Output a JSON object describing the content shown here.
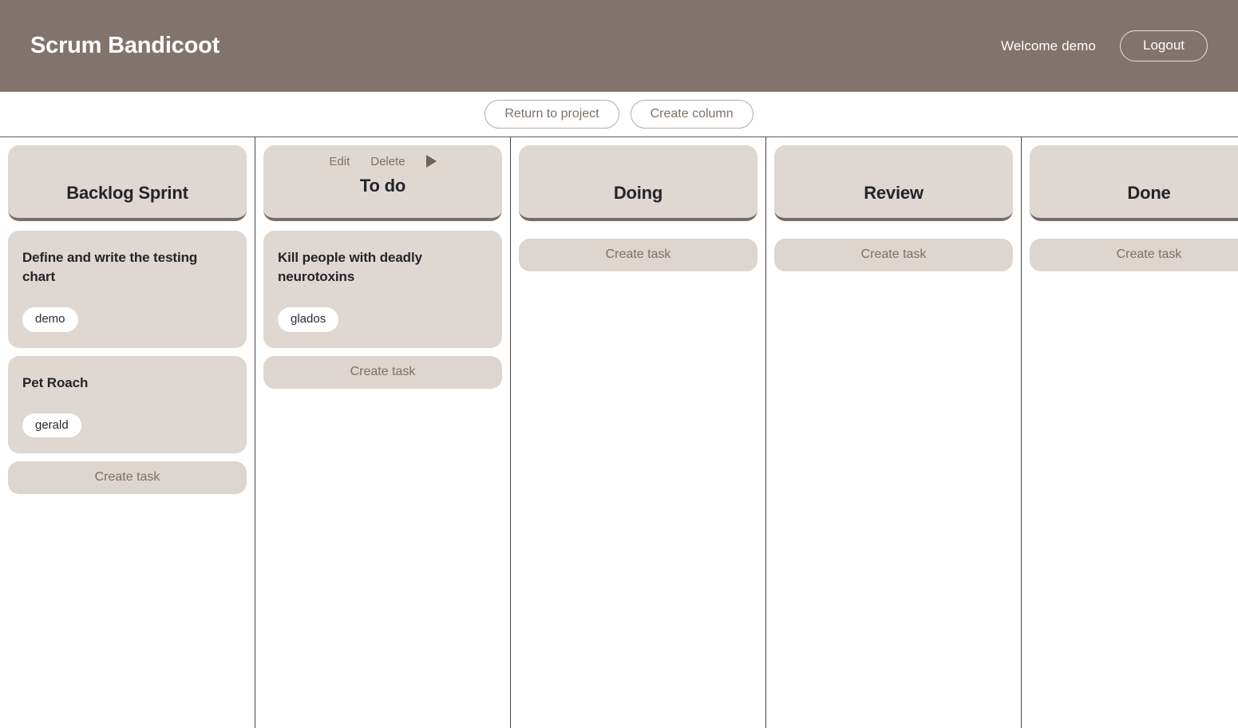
{
  "header": {
    "app_title": "Scrum Bandicoot",
    "welcome_text": "Welcome demo",
    "logout_label": "Logout"
  },
  "toolbar": {
    "return_label": "Return to project",
    "create_column_label": "Create column"
  },
  "board": {
    "create_task_label": "Create task",
    "column_actions": {
      "edit_label": "Edit",
      "delete_label": "Delete"
    },
    "columns": [
      {
        "title": "Backlog Sprint",
        "show_actions": false,
        "tasks": [
          {
            "title": "Define and write the testing chart",
            "assignee": "demo"
          },
          {
            "title": "Pet Roach",
            "assignee": "gerald"
          }
        ]
      },
      {
        "title": "To do",
        "show_actions": true,
        "tasks": [
          {
            "title": "Kill people with deadly neurotoxins",
            "assignee": "glados"
          }
        ]
      },
      {
        "title": "Doing",
        "show_actions": false,
        "tasks": []
      },
      {
        "title": "Review",
        "show_actions": false,
        "tasks": []
      },
      {
        "title": "Done",
        "show_actions": false,
        "tasks": []
      }
    ]
  },
  "colors": {
    "header_bar": "#82736d",
    "card": "#dfd7d1",
    "card_border_bottom": "#7a6b64",
    "muted_text": "#7d7068",
    "title_text": "#23242c"
  }
}
